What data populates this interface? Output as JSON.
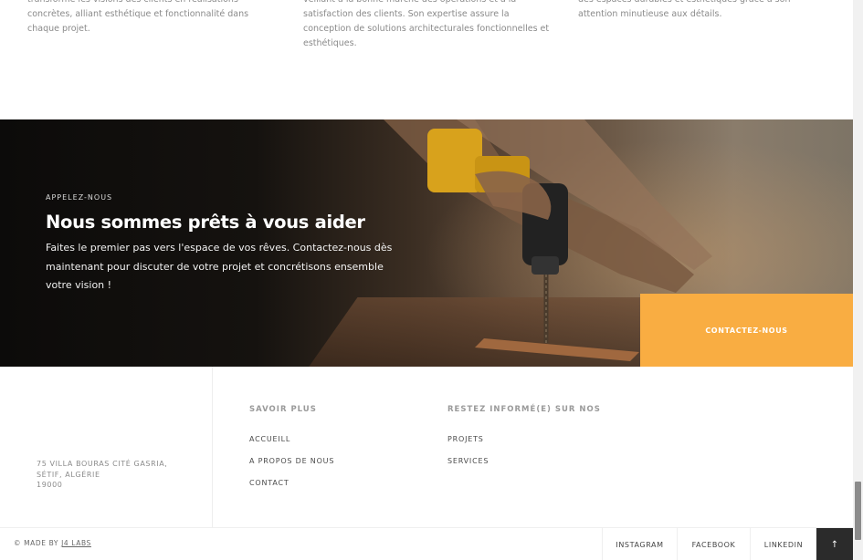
{
  "services_partial": {
    "col1": "transforme les visions des clients en réalisations concrètes, alliant esthétique et fonctionnalité dans chaque projet.",
    "col2": "veillant à la bonne marche des opérations et à la satisfaction des clients. Son expertise assure la conception de solutions architecturales fonctionnelles et esthétiques.",
    "col3": "des espaces durables et esthétiques grâce à son attention minutieuse aux détails."
  },
  "cta": {
    "eyebrow": "APPELEZ-NOUS",
    "title": "Nous sommes prêts à vous aider",
    "text": "Faites le premier pas vers l'espace de vos rêves. Contactez-nous dès maintenant pour discuter de votre projet et concrétisons ensemble votre vision !",
    "button": "CONTACTEZ-NOUS",
    "button_color": "#f9ad42"
  },
  "footer": {
    "address": [
      "75 VILLA BOURAS CITÉ GASRIA,",
      "SÉTIF, ALGÉRIE",
      "19000"
    ],
    "col1": {
      "heading": "SAVOIR PLUS",
      "links": [
        "ACCUEILL",
        "A PROPOS DE NOUS",
        "CONTACT"
      ]
    },
    "col2": {
      "heading": "RESTEZ INFORMÉ(E) SUR NOS",
      "links": [
        "PROJETS",
        "SERVICES"
      ]
    }
  },
  "bottom": {
    "madeby_prefix": "© MADE BY",
    "madeby_link": "J4 LABS",
    "social": [
      "INSTAGRAM",
      "FACEBOOK",
      "LINKEDIN"
    ],
    "totop_icon": "arrow-up-icon",
    "totop_glyph": "↑"
  }
}
